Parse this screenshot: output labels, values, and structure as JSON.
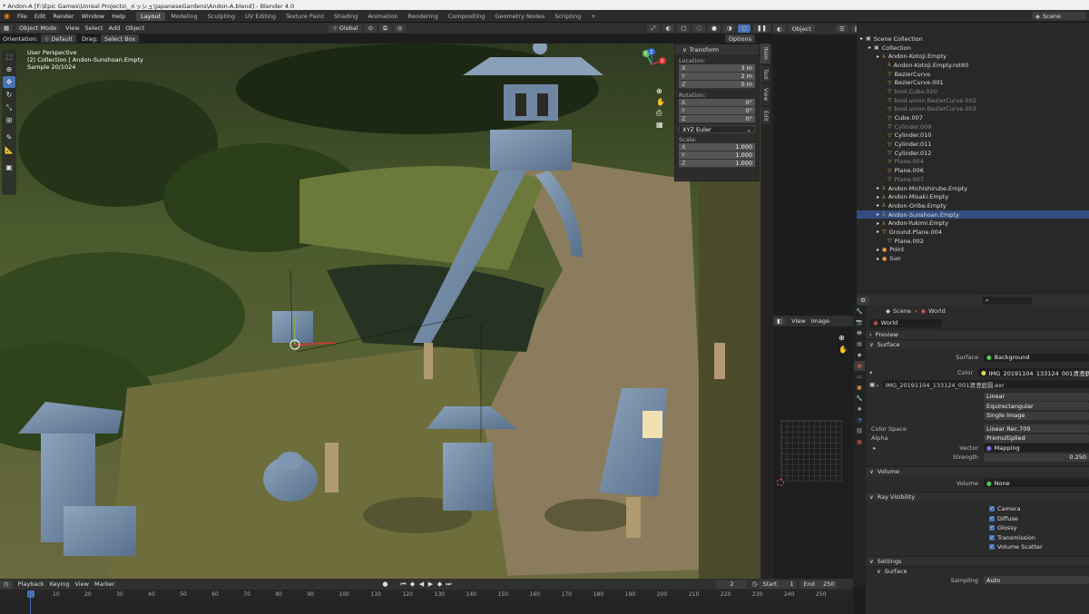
{
  "titlebar": {
    "text": "* Andon-A [F:\\Epic Games\\Unreal Projects\\_メッシュ\\JapaneseGardens\\Andon-A.blend] - Blender 4.0"
  },
  "menus": [
    "File",
    "Edit",
    "Render",
    "Window",
    "Help"
  ],
  "workspaces": [
    "Layout",
    "Modeling",
    "Sculpting",
    "UV Editing",
    "Texture Paint",
    "Shading",
    "Animation",
    "Rendering",
    "Compositing",
    "Geometry Nodes",
    "Scripting",
    "+"
  ],
  "scene_name": "Scene",
  "viewport_header": {
    "mode": "Object Mode",
    "menus": [
      "View",
      "Select",
      "Add",
      "Object"
    ],
    "transform_orientation": "Global",
    "shading_object": "Object",
    "orientation_label": "Orientation:",
    "orientation_value": "Default",
    "drag_label": "Drag:",
    "drag_value": "Select Box",
    "options_label": "Options"
  },
  "viewport_overlay": {
    "line1": "User Perspective",
    "line2": "(2) Collection | Andon-Sunshoan.Empty",
    "line3": "Sample 20/1024"
  },
  "gizmo": {
    "x": "X",
    "y": "Y",
    "z": "Z"
  },
  "n_panel": {
    "title": "Transform",
    "location_label": "Location:",
    "location": [
      {
        "axis": "X",
        "value": "3 m"
      },
      {
        "axis": "Y",
        "value": "2 m"
      },
      {
        "axis": "Z",
        "value": "0 m"
      }
    ],
    "rotation_label": "Rotation:",
    "rotation": [
      {
        "axis": "X",
        "value": "0°"
      },
      {
        "axis": "Y",
        "value": "0°"
      },
      {
        "axis": "Z",
        "value": "0°"
      }
    ],
    "rotation_mode": "XYZ Euler",
    "scale_label": "Scale:",
    "scale": [
      {
        "axis": "X",
        "value": "1.000"
      },
      {
        "axis": "Y",
        "value": "1.000"
      },
      {
        "axis": "Z",
        "value": "1.000"
      }
    ]
  },
  "side_tabs": [
    "Item",
    "Tool",
    "View",
    "Edit"
  ],
  "outliner": {
    "items": [
      {
        "label": "Scene Collection",
        "indent": 0,
        "style": "normal",
        "icon": "▣"
      },
      {
        "label": "Collection",
        "indent": 1,
        "style": "normal",
        "icon": "▣"
      },
      {
        "label": "Andon-Kotoji.Empty",
        "indent": 2,
        "style": "normal",
        "icon": "⅄"
      },
      {
        "label": "Andon-Kotoji.Empty.rot60",
        "indent": 3,
        "style": "normal",
        "icon": "⅄"
      },
      {
        "label": "BezierCurve",
        "indent": 3,
        "style": "normal",
        "icon": "▽"
      },
      {
        "label": "BezierCurve.001",
        "indent": 3,
        "style": "normal",
        "icon": "▽"
      },
      {
        "label": "bool.Cube.020",
        "indent": 3,
        "style": "dim",
        "icon": "▽"
      },
      {
        "label": "bool.union.BezierCurve.002",
        "indent": 3,
        "style": "dim",
        "icon": "▽"
      },
      {
        "label": "bool.union.BezierCurve.003",
        "indent": 3,
        "style": "dim",
        "icon": "▽"
      },
      {
        "label": "Cube.007",
        "indent": 3,
        "style": "normal",
        "icon": "▽"
      },
      {
        "label": "Cylinder.009",
        "indent": 3,
        "style": "dim",
        "icon": "▽"
      },
      {
        "label": "Cylinder.010",
        "indent": 3,
        "style": "normal",
        "icon": "▽"
      },
      {
        "label": "Cylinder.011",
        "indent": 3,
        "style": "normal",
        "icon": "▽"
      },
      {
        "label": "Cylinder.012",
        "indent": 3,
        "style": "normal",
        "icon": "▽"
      },
      {
        "label": "Plane.004",
        "indent": 3,
        "style": "dim",
        "icon": "▽"
      },
      {
        "label": "Plane.006",
        "indent": 3,
        "style": "normal",
        "icon": "▽"
      },
      {
        "label": "Plane.007",
        "indent": 3,
        "style": "dim",
        "icon": "▽"
      },
      {
        "label": "Andon-Michishirube.Empty",
        "indent": 2,
        "style": "normal",
        "icon": "⅄"
      },
      {
        "label": "Andon-Misaki.Empty",
        "indent": 2,
        "style": "normal",
        "icon": "⅄"
      },
      {
        "label": "Andon-Oribe.Empty",
        "indent": 2,
        "style": "normal",
        "icon": "⅄"
      },
      {
        "label": "Andon-Sunshoan.Empty",
        "indent": 2,
        "style": "sel",
        "icon": "⅄"
      },
      {
        "label": "Andon-Yukimi.Empty",
        "indent": 2,
        "style": "normal",
        "icon": "⅄"
      },
      {
        "label": "Ground.Plane.004",
        "indent": 2,
        "style": "normal",
        "icon": "▽"
      },
      {
        "label": "Plane.002",
        "indent": 3,
        "style": "normal",
        "icon": "▽"
      },
      {
        "label": "Point",
        "indent": 2,
        "style": "normal",
        "icon": "●"
      },
      {
        "label": "Sun",
        "indent": 2,
        "style": "normal",
        "icon": "●"
      }
    ]
  },
  "image_editor": {
    "menus": [
      "View",
      "Image"
    ]
  },
  "properties": {
    "breadcrumb_scene": "Scene",
    "breadcrumb_world": "World",
    "world_name": "World",
    "preview_label": "Preview",
    "surface_label": "Surface",
    "surface_key": "Surface",
    "surface_value": "Background",
    "color_key": "Color",
    "color_value": "IMG_20191104_133124_001清澄庭園",
    "image_name": "IMG_20191104_133124_001清澄庭園.exr",
    "interp": "Linear",
    "projection": "Equirectangular",
    "source": "Single Image",
    "color_space_key": "Color Space",
    "color_space_value": "Linear Rec.709",
    "alpha_key": "Alpha",
    "alpha_value": "Premultiplied",
    "vector_key": "Vector",
    "vector_value": "Mapping",
    "strength_key": "Strength",
    "strength_value": "0.250",
    "volume_label": "Volume",
    "volume_key": "Volume",
    "volume_value": "None",
    "ray_label": "Ray Visibility",
    "ray_items": [
      "Camera",
      "Diffuse",
      "Glossy",
      "Transmission",
      "Volume Scatter"
    ],
    "settings_label": "Settings",
    "settings_surface_label": "Surface",
    "sampling_key": "Sampling",
    "sampling_value": "Auto"
  },
  "timeline": {
    "menus": [
      "Playback",
      "Keying",
      "View",
      "Marker"
    ],
    "current_frame": "2",
    "start_label": "Start",
    "start_value": "1",
    "end_label": "End",
    "end_value": "250",
    "ticks": [
      "2",
      "10",
      "20",
      "30",
      "40",
      "50",
      "60",
      "70",
      "80",
      "90",
      "100",
      "110",
      "120",
      "130",
      "140",
      "150",
      "160",
      "170",
      "180",
      "190",
      "200",
      "210",
      "220",
      "230",
      "240",
      "250"
    ]
  }
}
